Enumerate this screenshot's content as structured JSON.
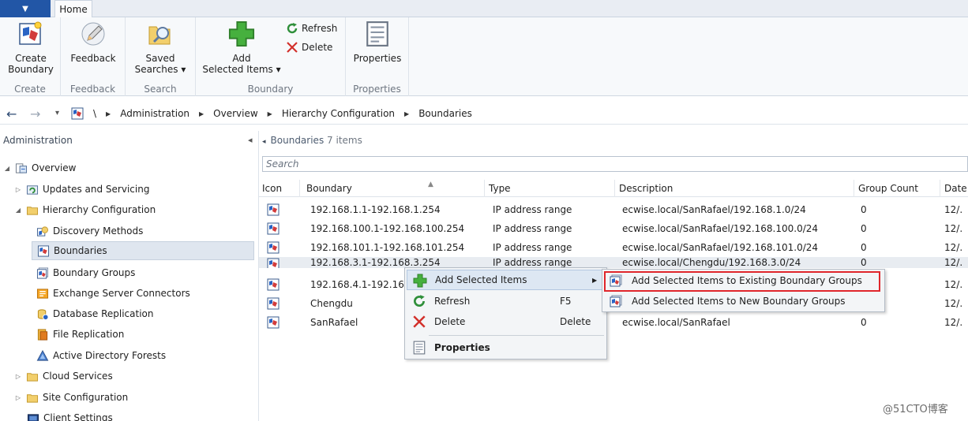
{
  "ribbon": {
    "app_menu_glyph": "▼",
    "tab_home": "Home",
    "groups": [
      {
        "label": "Create",
        "buttons": [
          {
            "line1": "Create",
            "line2": "Boundary",
            "icon": "boundary-icon"
          }
        ]
      },
      {
        "label": "Feedback",
        "buttons": [
          {
            "line1": "Feedback",
            "line2": "",
            "icon": "feedback-pencil-icon"
          }
        ]
      },
      {
        "label": "Search",
        "buttons": [
          {
            "line1": "Saved",
            "line2": "Searches ▾",
            "icon": "saved-search-icon"
          }
        ]
      },
      {
        "label": "Boundary",
        "buttons": [
          {
            "line1": "Add",
            "line2": "Selected Items ▾",
            "icon": "green-plus-icon"
          }
        ],
        "small": [
          {
            "label": "Refresh",
            "icon": "refresh-icon"
          },
          {
            "label": "Delete",
            "icon": "delete-x-icon"
          }
        ]
      },
      {
        "label": "Properties",
        "buttons": [
          {
            "line1": "Properties",
            "line2": "",
            "icon": "properties-icon"
          }
        ]
      }
    ]
  },
  "address": {
    "back": "←",
    "forward": "→",
    "dropdown": "▾",
    "root": "\\",
    "crumbs": [
      "Administration",
      "Overview",
      "Hierarchy Configuration",
      "Boundaries"
    ]
  },
  "nav": {
    "title": "Administration",
    "collapse_glyph": "◂",
    "items": [
      {
        "label": "Overview",
        "icon": "overview-icon"
      },
      {
        "label": "Updates and Servicing",
        "icon": "updates-icon"
      },
      {
        "label": "Hierarchy Configuration",
        "icon": "folder-icon"
      },
      {
        "label": "Discovery Methods",
        "icon": "discovery-icon"
      },
      {
        "label": "Boundaries",
        "icon": "boundary-icon"
      },
      {
        "label": "Boundary Groups",
        "icon": "boundary-group-icon"
      },
      {
        "label": "Exchange Server Connectors",
        "icon": "exchange-icon"
      },
      {
        "label": "Database Replication",
        "icon": "database-icon"
      },
      {
        "label": "File Replication",
        "icon": "file-replication-icon"
      },
      {
        "label": "Active Directory Forests",
        "icon": "ad-forest-icon"
      },
      {
        "label": "Cloud Services",
        "icon": "folder-icon"
      },
      {
        "label": "Site Configuration",
        "icon": "folder-icon"
      },
      {
        "label": "Client Settings",
        "icon": "client-settings-icon"
      }
    ]
  },
  "content": {
    "title": "Boundaries",
    "count": "7 items",
    "search_placeholder": "Search",
    "columns": [
      "Icon",
      "Boundary",
      "Type",
      "Description",
      "Group Count",
      "Date"
    ],
    "rows": [
      {
        "boundary": "192.168.1.1-192.168.1.254",
        "type": "IP address range",
        "description": "ecwise.local/SanRafael/192.168.1.0/24",
        "group_count": "0",
        "date": "12/."
      },
      {
        "boundary": "192.168.100.1-192.168.100.254",
        "type": "IP address range",
        "description": "ecwise.local/SanRafael/192.168.100.0/24",
        "group_count": "0",
        "date": "12/."
      },
      {
        "boundary": "192.168.101.1-192.168.101.254",
        "type": "IP address range",
        "description": "ecwise.local/SanRafael/192.168.101.0/24",
        "group_count": "0",
        "date": "12/."
      },
      {
        "boundary": "192.168.3.1-192.168.3.254",
        "type": "IP address range",
        "description": "ecwise.local/Chengdu/192.168.3.0/24",
        "group_count": "0",
        "date": "12/."
      },
      {
        "boundary": "192.168.4.1-192.168.4",
        "type": "",
        "description": "",
        "group_count": "",
        "date": "12/."
      },
      {
        "boundary": "Chengdu",
        "type": "",
        "description": "",
        "group_count": "",
        "date": "12/."
      },
      {
        "boundary": "SanRafael",
        "type": "",
        "description": "ecwise.local/SanRafael",
        "group_count": "0",
        "date": "12/."
      }
    ]
  },
  "context_menu": {
    "items": [
      {
        "label": "Add Selected Items",
        "shortcut": "",
        "submenu_glyph": "▶",
        "icon": "green-plus-icon"
      },
      {
        "label": "Refresh",
        "shortcut": "F5",
        "icon": "refresh-icon"
      },
      {
        "label": "Delete",
        "shortcut": "Delete",
        "icon": "delete-x-icon"
      },
      {
        "label": "Properties",
        "shortcut": "",
        "icon": "properties-icon"
      }
    ],
    "submenu": [
      {
        "label": "Add Selected Items to Existing Boundary Groups",
        "icon": "boundary-group-icon"
      },
      {
        "label": "Add Selected Items to New Boundary Groups",
        "icon": "boundary-group-icon"
      }
    ]
  },
  "watermark": "@51CTO博客",
  "colors": {
    "accent": "#2256a6",
    "highlight_red": "#e0262b",
    "selection": "#dfe6ef"
  }
}
